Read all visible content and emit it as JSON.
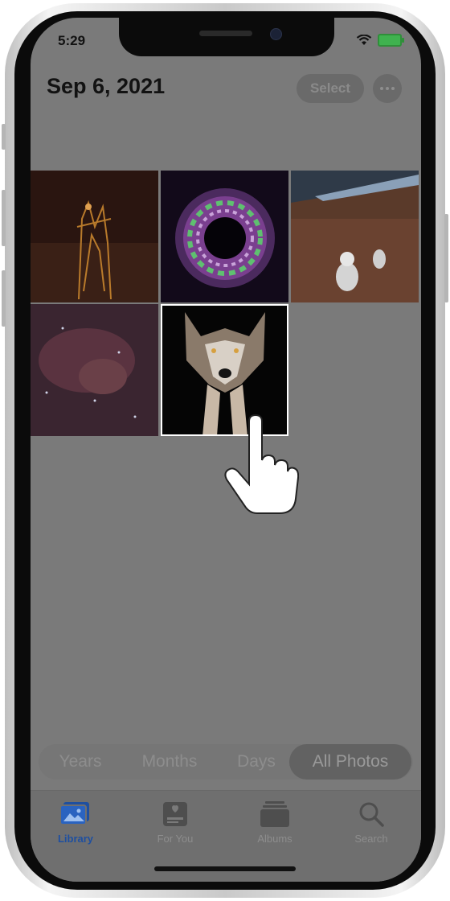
{
  "status_bar": {
    "time": "5:29"
  },
  "header": {
    "title": "Sep 6, 2021",
    "select_label": "Select"
  },
  "photos": [
    {
      "name": "photo-fire-figure",
      "selected": false
    },
    {
      "name": "photo-swirl",
      "selected": false
    },
    {
      "name": "photo-astronaut-mars",
      "selected": false
    },
    {
      "name": "photo-nebula",
      "selected": false
    },
    {
      "name": "photo-wolf",
      "selected": true
    }
  ],
  "view_switch": {
    "years": "Years",
    "months": "Months",
    "days": "Days",
    "all_photos": "All Photos",
    "active": "All Photos"
  },
  "tabbar": {
    "library": "Library",
    "for_you": "For You",
    "albums": "Albums",
    "search": "Search",
    "active": "Library"
  },
  "colors": {
    "accent": "#1e4fa0",
    "dim_overlay": "#7a7a7a",
    "battery": "#3fb24f"
  }
}
